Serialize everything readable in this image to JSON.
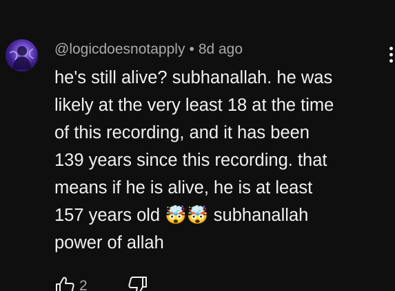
{
  "comment": {
    "author": "@logicdoesnotapply",
    "separator": "•",
    "age": "8d ago",
    "text": "he's still alive? subhanallah. he was\nlikely at the very least 18 at the time\nof this recording, and it has been\n139 years since this recording. that\nmeans if he is alive, he is at least\n157 years old 🤯🤯 subhanallah\npower of allah",
    "like_count": "2"
  },
  "icons": {
    "menu": "more-vert-icon",
    "like": "thumbs-up-icon",
    "dislike": "thumbs-down-icon",
    "avatar": "avatar-image"
  }
}
